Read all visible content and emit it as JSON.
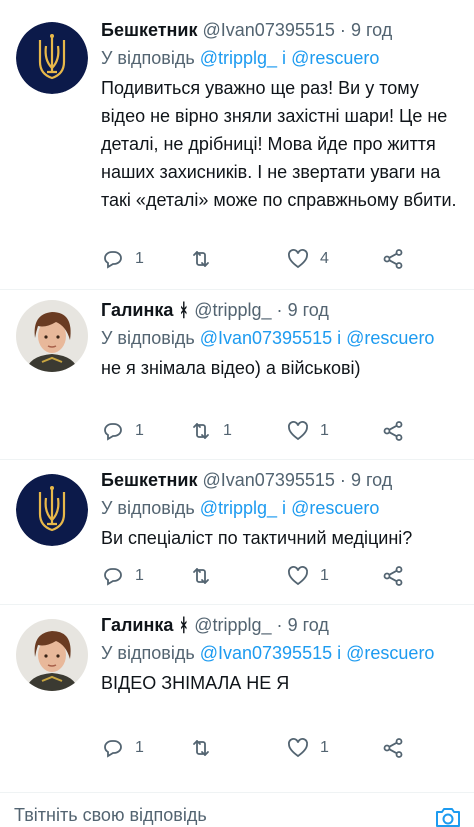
{
  "tweets": [
    {
      "name": "Бешкетник",
      "handle": "@Ivan07395515",
      "separator": "·",
      "time": "9 год",
      "reply_prefix": "У відповідь",
      "mention1": "@tripplg_",
      "conj": "і",
      "mention2": "@rescuero",
      "text": "Подивиться уважно ще раз! Ви у тому відео не вірно зняли захістні шари! Це не деталі, не дрібниці! Мова йде про життя наших захисників. І не звертати уваги на такі «деталі» може по справжньому вбити.",
      "replies": "1",
      "retweets": "",
      "likes": "4",
      "avatar": "trident-emblem"
    },
    {
      "name": "Галинка",
      "badge": "ᚼ",
      "handle": "@tripplg_",
      "separator": "·",
      "time": "9 год",
      "reply_prefix": "У відповідь",
      "mention1": "@Ivan07395515",
      "conj": "і",
      "mention2": "@rescuero",
      "text": "не я знімала відео) а військові)",
      "replies": "1",
      "retweets": "1",
      "likes": "1",
      "avatar": "girl-portrait"
    },
    {
      "name": "Бешкетник",
      "handle": "@Ivan07395515",
      "separator": "·",
      "time": "9 год",
      "reply_prefix": "У відповідь",
      "mention1": "@tripplg_",
      "conj": "і",
      "mention2": "@rescuero",
      "text": "Ви спеціаліст по тактичний медіцині?",
      "replies": "1",
      "retweets": "",
      "likes": "1",
      "avatar": "trident-emblem"
    },
    {
      "name": "Галинка",
      "badge": "ᚼ",
      "handle": "@tripplg_",
      "separator": "·",
      "time": "9 год",
      "reply_prefix": "У відповідь",
      "mention1": "@Ivan07395515",
      "conj": "і",
      "mention2": "@rescuero",
      "text": "ВІДЕО ЗНІМАЛА НЕ Я",
      "replies": "1",
      "retweets": "",
      "likes": "1",
      "avatar": "girl-portrait"
    }
  ],
  "compose": {
    "placeholder": "Твітніть свою відповідь",
    "icon": "camera-icon"
  },
  "colors": {
    "accent": "#1d9bf0",
    "muted": "#536471",
    "text": "#0f1419",
    "emblem_bg": "#0c1a4a",
    "emblem_gold": "#e8b84a"
  }
}
